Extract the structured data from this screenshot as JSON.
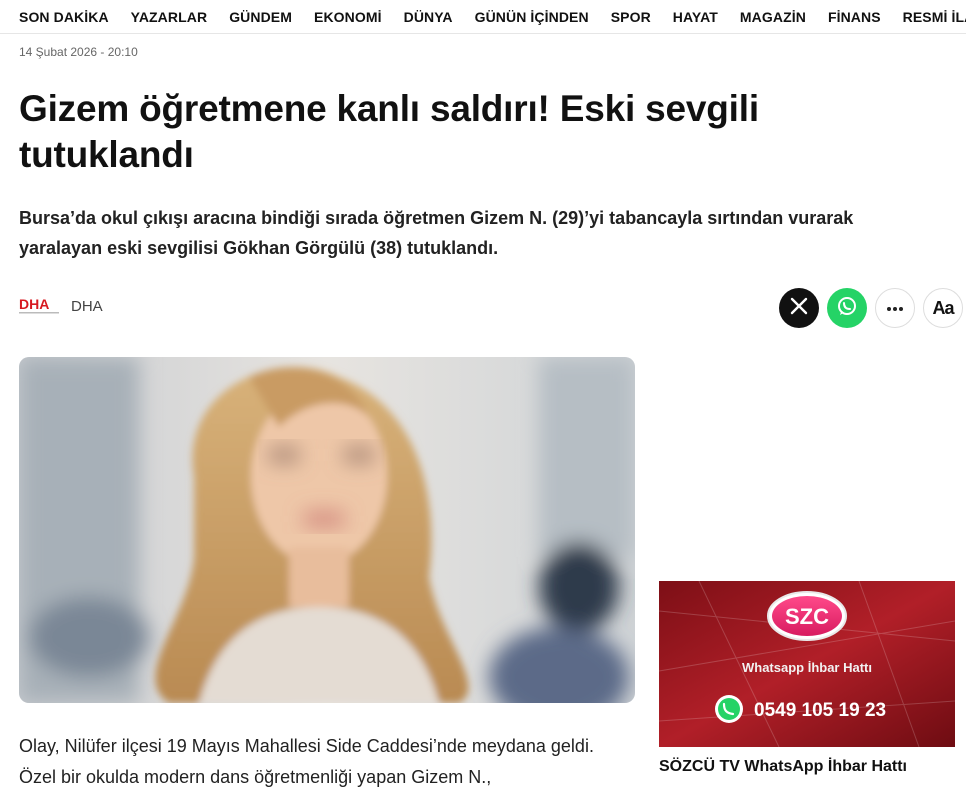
{
  "nav": {
    "items": [
      "SON DAKİKA",
      "YAZARLAR",
      "GÜNDEM",
      "EKONOMİ",
      "DÜNYA",
      "GÜNÜN İÇİNDEN",
      "SPOR",
      "HAYAT",
      "MAGAZİN",
      "FİNANS",
      "RESMİ İLAN"
    ]
  },
  "article": {
    "date": "14 Şubat 2026 - 20:10",
    "title": "Gizem öğretmene kanlı saldırı! Eski sevgili tutuklandı",
    "summary": "Bursa’da okul çıkışı aracına bindiği sırada öğretmen Gizem N. (29)’yi tabancayla sırtından vurarak yaralayan eski sevgilisi Gökhan Görgülü (38) tutuklandı.",
    "source": "DHA",
    "source_logo_text": "DHA",
    "body": "Olay, Nilüfer ilçesi 19 Mayıs Mahallesi Side Caddesi’nde meydana geldi. Özel bir okulda modern dans öğretmenliği yapan Gizem N.,"
  },
  "share": {
    "icons": [
      "x-icon",
      "whatsapp-icon",
      "more-icon",
      "font-size-icon"
    ],
    "font_label": "Aa"
  },
  "ad": {
    "logo": "SZC",
    "line": "Whatsapp İhbar Hattı",
    "phone": "0549 105 19 23",
    "caption": "SÖZCÜ TV WhatsApp İhbar Hattı"
  },
  "colors": {
    "whatsapp": "#25d366",
    "x": "#111111",
    "ad_bg": "#9e1a22",
    "dha": "#d71920"
  }
}
